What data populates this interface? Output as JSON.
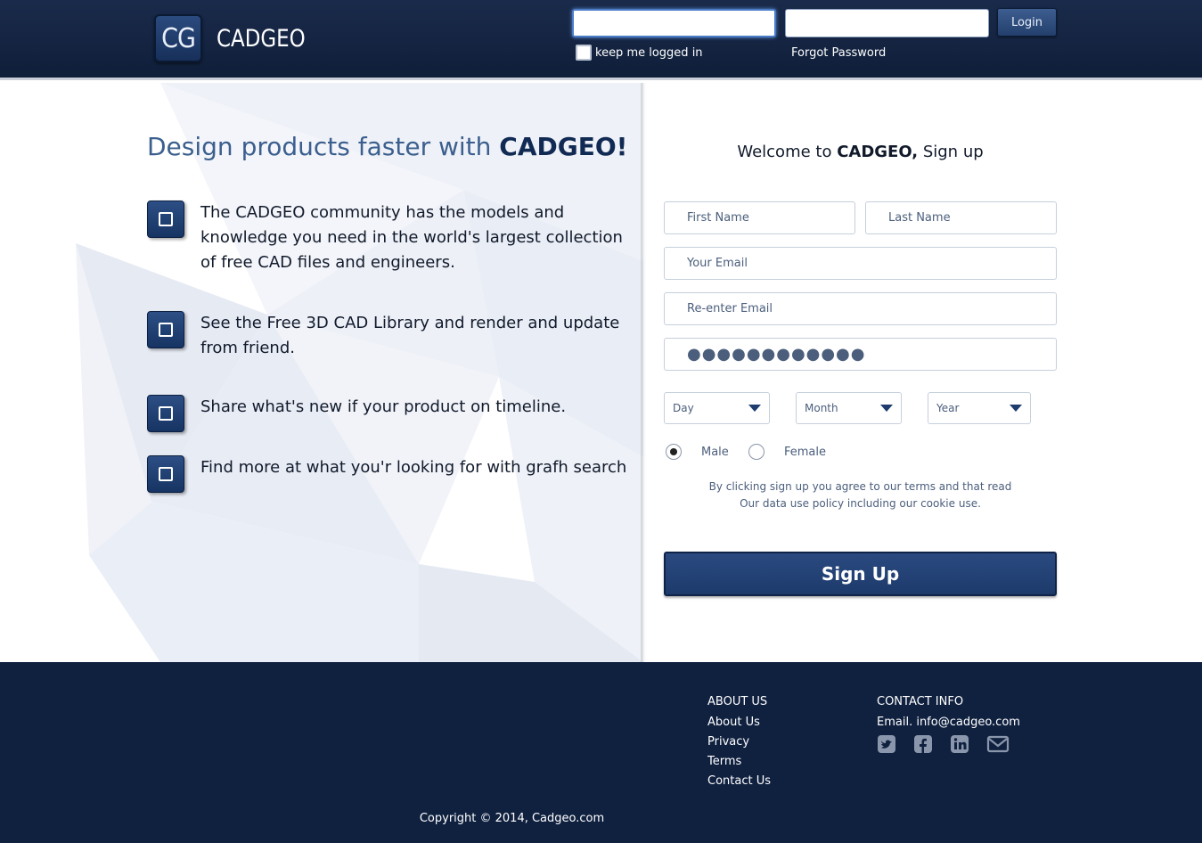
{
  "header": {
    "logo_badge": "CG",
    "logo_text": "CADGEO",
    "username_value": "",
    "password_value": "",
    "login_label": "Login",
    "keep_logged_in_label": "keep me logged in",
    "forgot_password_label": "Forgot Password"
  },
  "hero": {
    "headline_prefix": "Design products faster with ",
    "headline_brand": "CADGEO!",
    "features": [
      "The CADGEO community has the models and knowledge you need in the world's largest collection of free CAD files and engineers.",
      "See the Free 3D CAD Library and render and update from friend.",
      "Share what's new if your product on timeline.",
      "Find more at what you'r looking for with grafh search"
    ]
  },
  "signup": {
    "welcome_prefix": "Welcome to ",
    "welcome_brand": "CADGEO,",
    "welcome_suffix": " Sign up",
    "first_name_placeholder": "First Name",
    "last_name_placeholder": "Last Name",
    "email_placeholder": "Your Email",
    "reenter_email_placeholder": "Re-enter Email",
    "password_value": "●●●●●●●●●●●●",
    "day_label": "Day",
    "month_label": "Month",
    "year_label": "Year",
    "male_label": "Male",
    "female_label": "Female",
    "selected_gender": "Male",
    "terms_line1": "By clicking sign up you agree to our terms and that read",
    "terms_line2": "Our data use policy including our cookie use.",
    "signup_label": "Sign Up"
  },
  "footer": {
    "about_heading": "ABOUT US",
    "about_links": [
      "About Us",
      "Privacy",
      "Terms",
      "Contact Us"
    ],
    "contact_heading": "CONTACT INFO",
    "contact_email": "Email. info@cadgeo.com",
    "social_icons": [
      "twitter-icon",
      "facebook-icon",
      "linkedin-icon",
      "mail-icon"
    ],
    "copyright": "Copyright © 2014, Cadgeo.com"
  },
  "colors": {
    "navy": "#102140",
    "accent": "#1d3a6b",
    "headline_blue": "#3b5f8e"
  }
}
